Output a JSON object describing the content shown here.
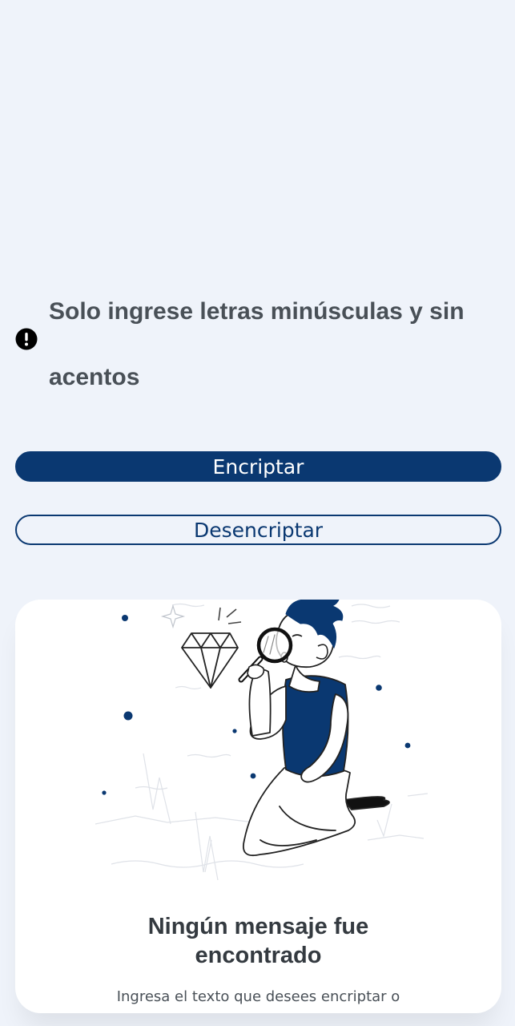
{
  "warning": {
    "icon": "exclamation-circle-icon",
    "text": "Solo ingrese letras minúsculas y sin acentos"
  },
  "actions": {
    "encrypt_label": "Encriptar",
    "decrypt_label": "Desencriptar"
  },
  "output": {
    "illustration": "person-with-magnifying-glass-diamond",
    "title": "Ningún mensaje fue encontrado",
    "text": "Ingresa el texto que desees encriptar o"
  },
  "colors": {
    "page_background": "#eff3fa",
    "primary": "#0a3871",
    "text_dark": "#343a40",
    "text_muted": "#495057",
    "card_background": "#ffffff"
  }
}
